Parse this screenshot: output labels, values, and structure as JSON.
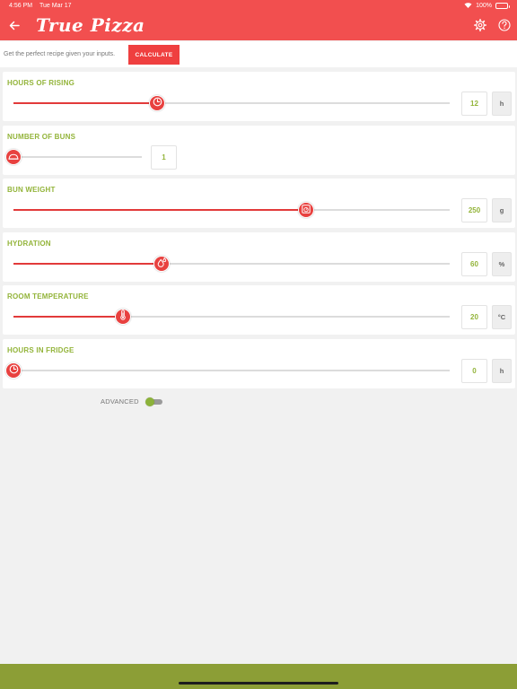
{
  "status_bar": {
    "time": "4:56 PM",
    "date": "Tue Mar 17",
    "battery": "100%"
  },
  "header": {
    "title": "True Pizza",
    "background_color": "#f24f4f"
  },
  "intro": {
    "text": "Get the perfect recipe given your inputs.",
    "calculate_label": "CALCULATE"
  },
  "sliders": [
    {
      "label": "HOURS OF RISING",
      "value": "12",
      "unit": "h",
      "fraction": 0.33,
      "icon": "clock-icon"
    },
    {
      "label": "NUMBER OF BUNS",
      "value": "1",
      "unit": "",
      "fraction": 0.0,
      "icon": "bun-icon"
    },
    {
      "label": "BUN WEIGHT",
      "value": "250",
      "unit": "g",
      "fraction": 0.67,
      "icon": "scale-icon"
    },
    {
      "label": "HYDRATION",
      "value": "60",
      "unit": "%",
      "fraction": 0.34,
      "icon": "water-drops-icon"
    },
    {
      "label": "ROOM TEMPERATURE",
      "value": "20",
      "unit": "°C",
      "fraction": 0.25,
      "icon": "thermometer-icon"
    },
    {
      "label": "HOURS IN FRIDGE",
      "value": "0",
      "unit": "h",
      "fraction": 0.0,
      "icon": "clock-icon"
    }
  ],
  "advanced": {
    "label": "ADVANCED",
    "enabled": false
  },
  "colors": {
    "accent_red": "#e8413f",
    "label_green": "#93b43a",
    "footer_olive": "#8c9e36"
  }
}
